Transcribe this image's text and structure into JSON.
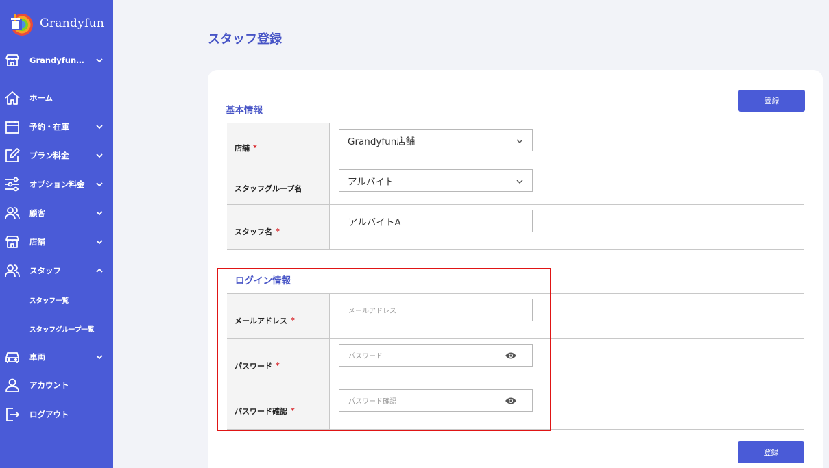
{
  "app": {
    "name": "Grandyfun"
  },
  "sidebar": {
    "store_select": "Grandyfun…",
    "items": [
      {
        "label": "ホーム",
        "icon": "home-icon"
      },
      {
        "label": "予約・在庫",
        "icon": "calendar-icon"
      },
      {
        "label": "プラン料金",
        "icon": "edit-icon"
      },
      {
        "label": "オプション料金",
        "icon": "sliders-icon"
      },
      {
        "label": "顧客",
        "icon": "users-icon"
      },
      {
        "label": "店舗",
        "icon": "store-icon"
      },
      {
        "label": "スタッフ",
        "icon": "staff-icon"
      },
      {
        "label": "車両",
        "icon": "car-icon"
      },
      {
        "label": "アカウント",
        "icon": "account-icon"
      },
      {
        "label": "ログアウト",
        "icon": "logout-icon"
      }
    ],
    "staff_sub": [
      "スタッフ一覧",
      "スタッフグループ一覧"
    ]
  },
  "page": {
    "title": "スタッフ登録"
  },
  "buttons": {
    "register": "登録"
  },
  "basic": {
    "title": "基本情報",
    "store_label": "店舗",
    "store_value": "Grandyfun店舗",
    "group_label": "スタッフグループ名",
    "group_value": "アルバイト",
    "name_label": "スタッフ名",
    "name_value": "アルバイトA"
  },
  "login": {
    "title": "ログイン情報",
    "email_label": "メールアドレス",
    "email_placeholder": "メールアドレス",
    "password_label": "パスワード",
    "password_placeholder": "パスワード",
    "confirm_label": "パスワード確認",
    "confirm_placeholder": "パスワード確認"
  },
  "required_mark": "*",
  "colors": {
    "sidebar": "#4a5bd7",
    "accent": "#4754c6",
    "highlight": "#e01515",
    "required": "#d9262b"
  }
}
